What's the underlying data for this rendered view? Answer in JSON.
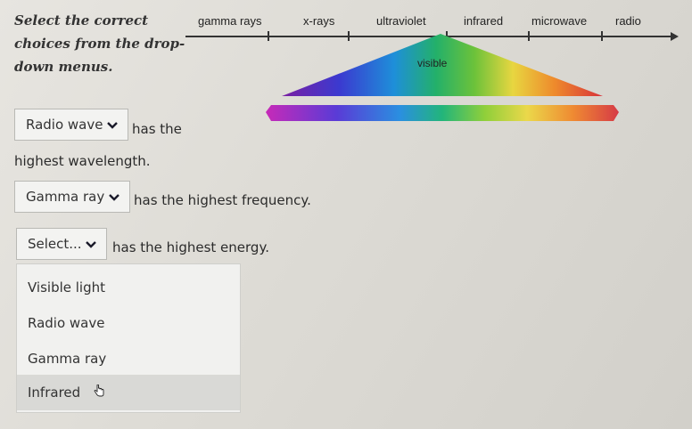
{
  "instructions": "Select the correct choices from the drop-down menus.",
  "spectrum": {
    "labels": [
      "gamma rays",
      "x-rays",
      "ultraviolet",
      "infrared",
      "microwave",
      "radio"
    ],
    "visible_label": "visible"
  },
  "question1": {
    "selected": "Radio wave",
    "text_a": "has the",
    "text_b": "highest wavelength."
  },
  "question2": {
    "selected": "Gamma ray",
    "text": "has the highest frequency."
  },
  "question3": {
    "selected": "Select...",
    "text": "has the highest energy.",
    "options": [
      "Visible light",
      "Radio wave",
      "Gamma ray",
      "Infrared"
    ],
    "hovered_option": "Infrared"
  },
  "icons": {
    "dropdown": "chevron-down-icon",
    "cursor": "hand-pointer-icon"
  }
}
